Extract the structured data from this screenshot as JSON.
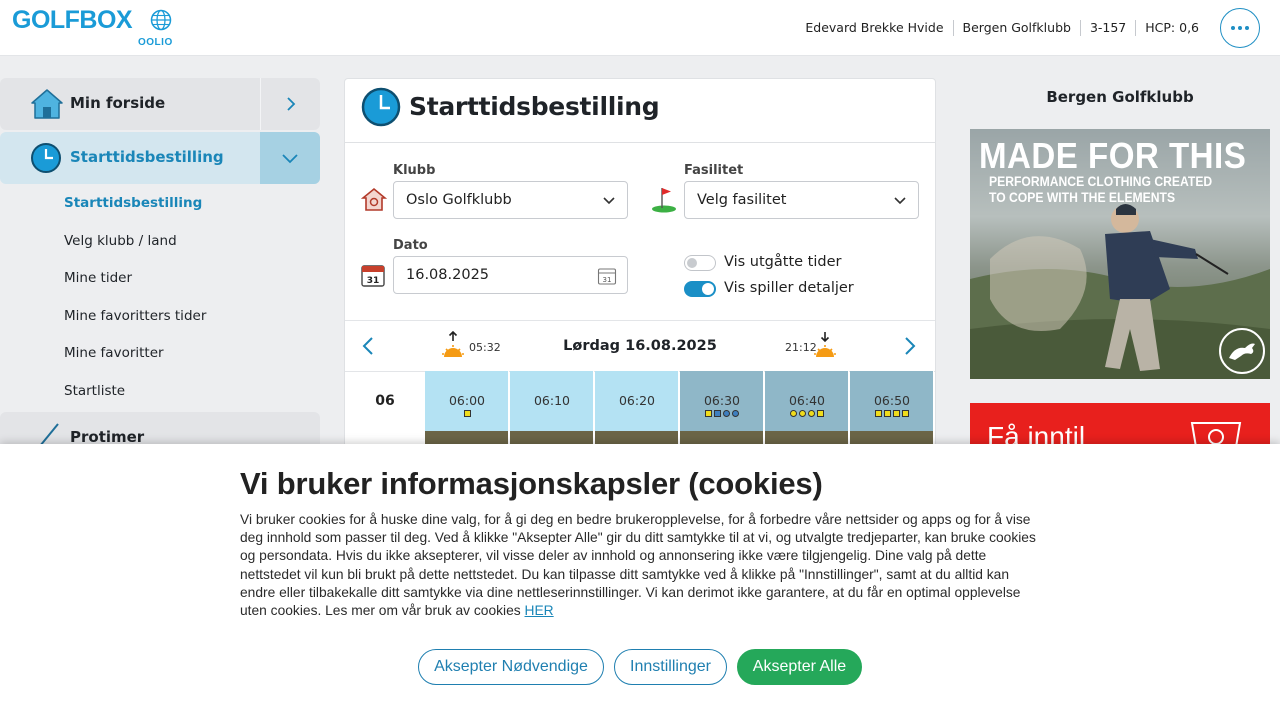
{
  "header": {
    "logo_text": "GOLFBOX",
    "logo_sub": "OOLIO",
    "user_name": "Edevard Brekke Hvide",
    "club": "Bergen Golfklubb",
    "member_id": "3-157",
    "hcp": "HCP: 0,6",
    "more_icon": "ellipsis-icon"
  },
  "sidebar": {
    "items": [
      {
        "label": "Min forside",
        "icon": "home-icon",
        "toggle_icon": "chevron-right-icon"
      },
      {
        "label": "Starttidsbestilling",
        "icon": "clock-icon",
        "toggle_icon": "chevron-down-icon"
      },
      {
        "label": "Protimer",
        "icon": "golf-club-icon"
      }
    ],
    "sub_items": [
      {
        "label": "Starttidsbestilling"
      },
      {
        "label": "Velg klubb / land"
      },
      {
        "label": "Mine tider"
      },
      {
        "label": "Mine favoritters tider"
      },
      {
        "label": "Mine favoritter"
      },
      {
        "label": "Startliste"
      }
    ]
  },
  "main": {
    "title": "Starttidsbestilling",
    "klubb_label": "Klubb",
    "klubb_value": "Oslo Golfklubb",
    "fasilitet_label": "Fasilitet",
    "fasilitet_value": "Velg fasilitet",
    "dato_label": "Dato",
    "dato_value": "16.08.2025",
    "toggle_expired_label": "Vis utgåtte tider",
    "toggle_details_label": "Vis spiller detaljer",
    "date_title": "Lørdag 16.08.2025",
    "sunrise": "05:32",
    "sunset": "21:12",
    "hour": "06",
    "slots": [
      {
        "time": "06:00",
        "marks": [
          "sq-y"
        ],
        "bg": "#b4e2f3"
      },
      {
        "time": "06:10",
        "marks": [],
        "bg": "#b4e2f3"
      },
      {
        "time": "06:20",
        "marks": [],
        "bg": "#b4e2f3"
      },
      {
        "time": "06:30",
        "marks": [
          "sq-y",
          "sq-b",
          "ci-b",
          "ci-b"
        ],
        "bg": "#8fb7c8"
      },
      {
        "time": "06:40",
        "marks": [
          "ci-y",
          "ci-y",
          "ci-y",
          "sq-y"
        ],
        "bg": "#8fb7c8"
      },
      {
        "time": "06:50",
        "marks": [
          "sq-y",
          "sq-y",
          "sq-y",
          "sq-y"
        ],
        "bg": "#8fb7c8"
      }
    ]
  },
  "right": {
    "club_title": "Bergen Golfklubb",
    "ad1_headline": "MADE FOR THIS",
    "ad1_sub1": "PERFORMANCE CLOTHING CREATED",
    "ad1_sub2": "TO COPE WITH THE ELEMENTS",
    "ad2_text": "Få inntil"
  },
  "cookie": {
    "title": "Vi bruker informasjonskapsler (cookies)",
    "body": "Vi bruker cookies for å huske dine valg, for å gi deg en bedre brukeropplevelse, for å forbedre våre nettsider og apps og for å vise deg innhold som passer til deg. Ved å klikke \"Aksepter Alle\" gir du ditt samtykke til at vi, og utvalgte tredjeparter, kan bruke cookies og persondata. Hvis du ikke aksepterer, vil visse deler av innhold og annonsering ikke være tilgjengelig. Dine valg på dette nettstedet vil kun bli brukt på dette nettstedet. Du kan tilpasse ditt samtykke ved å klikke på \"Innstillinger\", samt at du alltid kan endre eller tilbakekalle ditt samtykke via dine nettleserinnstillinger. Vi kan derimot ikke garantere, at du får en optimal opplevelse uten cookies. Les mer om vår bruk av cookies",
    "link": "HER",
    "btn_necessary": "Aksepter Nødvendige",
    "btn_settings": "Innstillinger",
    "btn_all": "Aksepter Alle"
  }
}
